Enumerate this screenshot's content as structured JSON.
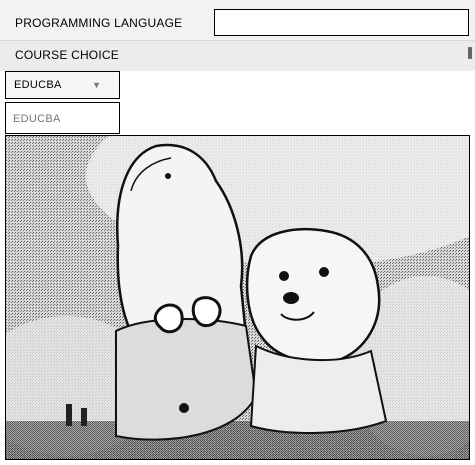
{
  "form": {
    "language_label": "PROGRAMMING LANGUAGE",
    "language_value": "",
    "course_label": "COURSE CHOICE",
    "combo_value": "EDUCBA",
    "dropdown_options": [
      "EDUCBA"
    ]
  },
  "image": {
    "description_icon": "dogs-photo-icon"
  }
}
